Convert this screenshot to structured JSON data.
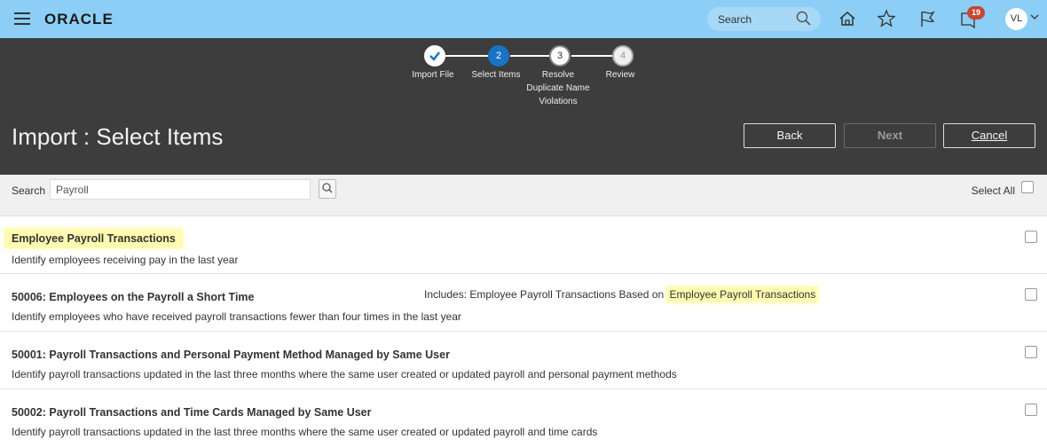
{
  "topbar": {
    "logo": "ORACLE",
    "search_placeholder": "Search",
    "notification_count": "19",
    "avatar_initials": "VL"
  },
  "train": {
    "steps": [
      {
        "number": "",
        "label": "Import File",
        "state": "done"
      },
      {
        "number": "2",
        "label": "Select Items",
        "state": "current"
      },
      {
        "number": "3",
        "label": "Resolve Duplicate Name Violations",
        "state": "next"
      },
      {
        "number": "4",
        "label": "Review",
        "state": "future"
      }
    ]
  },
  "header": {
    "title": "Import : Select Items",
    "back_label": "Back",
    "next_label": "Next",
    "cancel_label": "Cancel"
  },
  "search": {
    "label": "Search",
    "value": "Payroll",
    "select_all_label": "Select All"
  },
  "items": [
    {
      "title": "Employee Payroll Transactions",
      "description": "Identify employees receiving pay in the last year",
      "highlighted": true
    },
    {
      "title": "50006: Employees on the Payroll a Short Time",
      "description": "Identify employees who have received payroll transactions fewer than four times in the last year",
      "includes_prefix": "Includes: Employee Payroll Transactions Based on ",
      "includes_highlight": "Employee Payroll Transactions"
    },
    {
      "title": "50001: Payroll Transactions and Personal Payment Method Managed by Same User",
      "description": "Identify payroll transactions updated in the last three months where the same user created or updated payroll and personal payment methods"
    },
    {
      "title": "50002: Payroll Transactions and Time Cards Managed by Same User",
      "description": "Identify payroll transactions updated in the last three months where the same user created or updated payroll and time cards"
    }
  ],
  "colors": {
    "topbar": "#8ccef5",
    "header": "#3d3d3d",
    "current_step": "#1a73c6",
    "highlight": "#fffbb0",
    "badge": "#c74634"
  }
}
